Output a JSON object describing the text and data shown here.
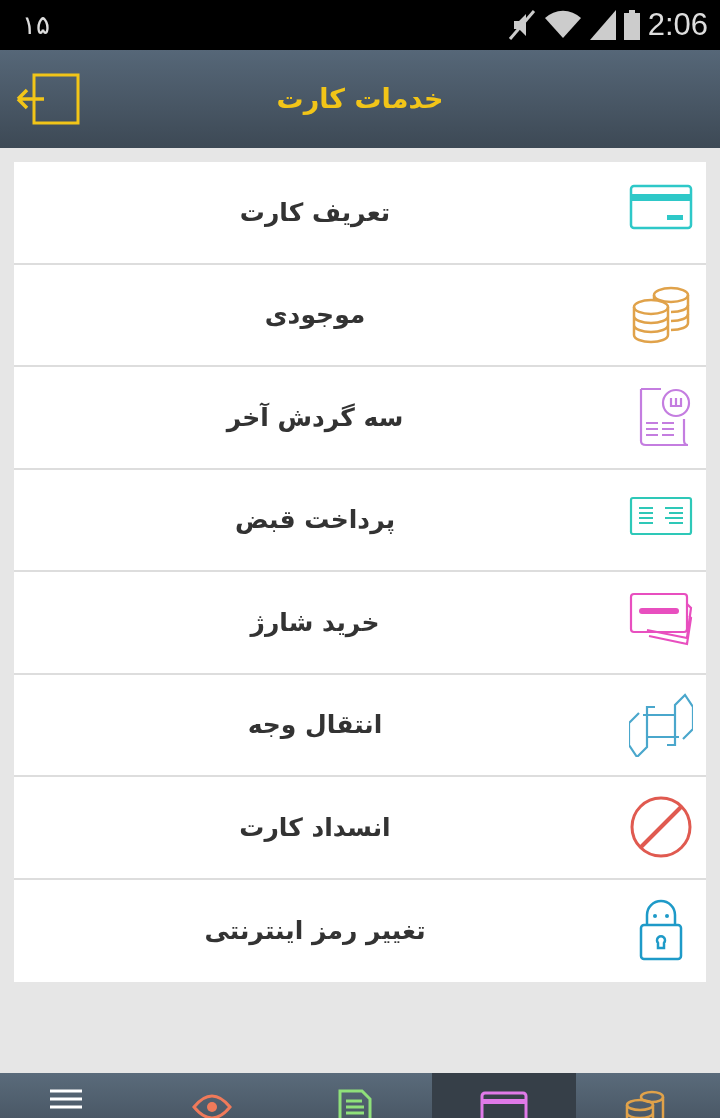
{
  "status_bar": {
    "notification": "۱۵",
    "time": "2:06"
  },
  "header": {
    "title": "خدمات کارت"
  },
  "menu_items": [
    {
      "label": "تعریف کارت"
    },
    {
      "label": "موجودی"
    },
    {
      "label": "سه گردش آخر"
    },
    {
      "label": "پرداخت قبض"
    },
    {
      "label": "خرید شارژ"
    },
    {
      "label": "انتقال وجه"
    },
    {
      "label": "انسداد کارت"
    },
    {
      "label": "تغییر رمز اینترنتی"
    }
  ],
  "bottom_tabs": [
    {
      "selected": false
    },
    {
      "selected": false
    },
    {
      "selected": false
    },
    {
      "selected": true
    },
    {
      "selected": false
    }
  ]
}
